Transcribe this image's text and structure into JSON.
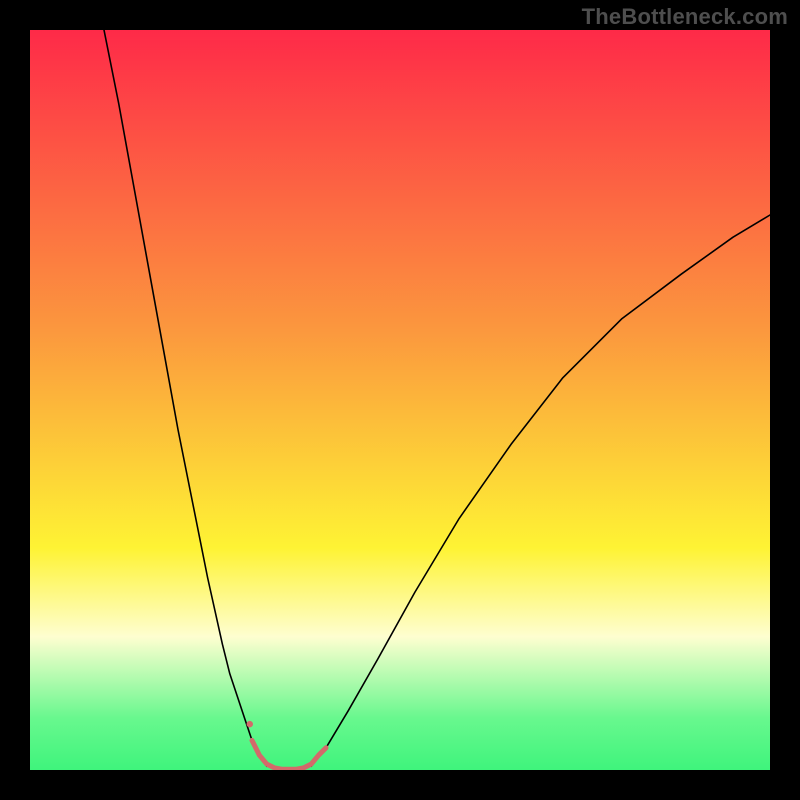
{
  "watermark": "TheBottleneck.com",
  "colors": {
    "frame_bg": "#000000",
    "gradient_top": "#fe2a48",
    "gradient_mid1": "#fb963e",
    "gradient_mid2": "#fef334",
    "gradient_band": "#fefed0",
    "gradient_green_top": "#68f88e",
    "gradient_green_bot": "#3ff47c",
    "curve": "#000000",
    "marker_stroke": "#d36a6a",
    "marker_fill": "#d36a6a",
    "watermark": "#4e4e4e"
  },
  "chart_data": {
    "type": "line",
    "title": "",
    "xlabel": "",
    "ylabel": "",
    "xlim": [
      0,
      100
    ],
    "ylim": [
      0,
      100
    ],
    "axes_visible": false,
    "grid": false,
    "legend": false,
    "background_gradient": [
      {
        "stop": 0.0,
        "color": "#fe2a48"
      },
      {
        "stop": 0.4,
        "color": "#fb963e"
      },
      {
        "stop": 0.7,
        "color": "#fef334"
      },
      {
        "stop": 0.82,
        "color": "#fefed0"
      },
      {
        "stop": 0.93,
        "color": "#68f88e"
      },
      {
        "stop": 1.0,
        "color": "#3ff47c"
      }
    ],
    "series": [
      {
        "name": "left-branch",
        "stroke": "#000000",
        "stroke_width": 1.6,
        "x": [
          10,
          12,
          14,
          16,
          18,
          20,
          22,
          24,
          26,
          27,
          28,
          29,
          30,
          31,
          32
        ],
        "y": [
          100,
          90,
          79,
          68,
          57,
          46,
          36,
          26,
          17,
          13,
          10,
          7,
          4,
          2,
          0.5
        ]
      },
      {
        "name": "right-branch",
        "stroke": "#000000",
        "stroke_width": 1.6,
        "x": [
          38,
          40,
          43,
          47,
          52,
          58,
          65,
          72,
          80,
          88,
          95,
          100
        ],
        "y": [
          0.5,
          3,
          8,
          15,
          24,
          34,
          44,
          53,
          61,
          67,
          72,
          75
        ]
      },
      {
        "name": "highlighted-bottom",
        "stroke": "#d36a6a",
        "stroke_width": 5,
        "x": [
          30,
          31,
          32,
          33,
          34,
          35,
          36,
          37,
          38,
          39,
          40
        ],
        "y": [
          4,
          2,
          0.8,
          0.3,
          0.1,
          0.1,
          0.1,
          0.3,
          0.8,
          2,
          3
        ]
      }
    ],
    "markers": [
      {
        "x": 29.7,
        "y": 6.2,
        "r": 3.2,
        "color": "#d36a6a"
      }
    ]
  }
}
